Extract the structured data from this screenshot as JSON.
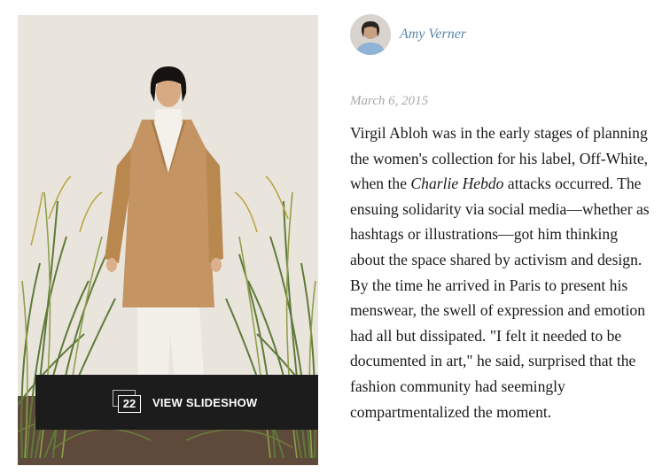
{
  "author": {
    "name": "Amy Verner",
    "avatar_icon": "author-avatar"
  },
  "article": {
    "date": "March 6, 2015",
    "body_before": "Virgil Abloh was in the early stages of planning the women's collection for his label, Off-White, when the ",
    "body_italic": "Charlie Hebdo",
    "body_after": " attacks occurred. The ensuing solidarity via social media—whether as hashtags or illustrations—got him thinking about the space shared by activism and design. By the time he arrived in Paris to present his menswear, the swell of expression and emotion had all but dissipated. \"I felt it needed to be documented in art,\" he said, surprised that the fashion community had seemingly compartmentalized the moment."
  },
  "slideshow": {
    "count": "22",
    "label": "VIEW SLIDESHOW",
    "icon": "stacked-slides-icon"
  },
  "colors": {
    "author_link": "#5a86ad",
    "date": "#a8a8a8",
    "body_text": "#1a1a1a",
    "slideshow_bar": "#1c1c1c",
    "coat": "#c49462",
    "backdrop": "#eae6de"
  }
}
